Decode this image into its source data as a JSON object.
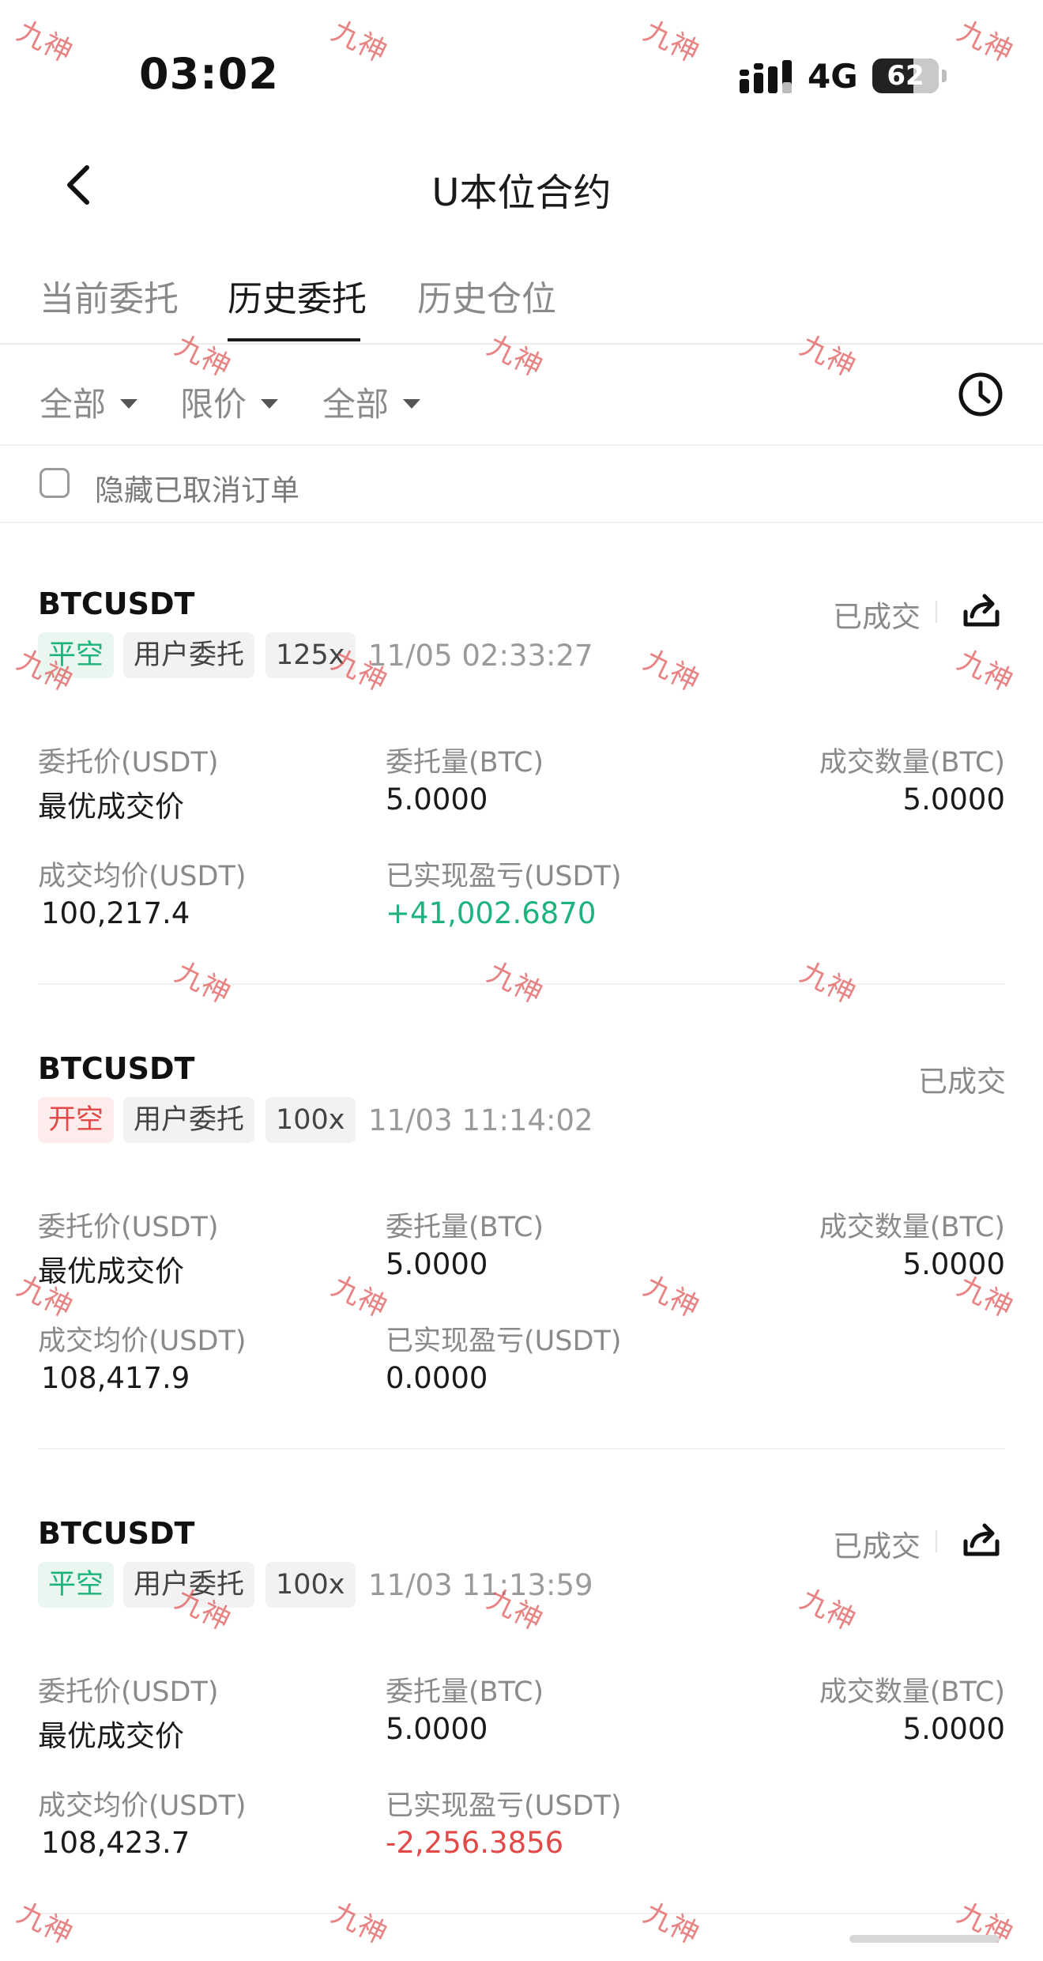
{
  "status_bar": {
    "time": "03:02",
    "network": "4G",
    "battery": "62",
    "battery_level": 0.62
  },
  "header": {
    "title": "U本位合约",
    "back_icon": "chevron-left-icon"
  },
  "tabs": [
    {
      "label": "当前委托",
      "active": false
    },
    {
      "label": "历史委托",
      "active": true
    },
    {
      "label": "历史仓位",
      "active": false
    }
  ],
  "filters": [
    {
      "label": "全部"
    },
    {
      "label": "限价"
    },
    {
      "label": "全部"
    }
  ],
  "history_icon": "clock-icon",
  "hide_cancelled": {
    "label": "隐藏已取消订单",
    "checked": false
  },
  "labels": {
    "order_price": "委托价(USDT)",
    "order_qty": "委托量(BTC)",
    "filled_qty": "成交数量(BTC)",
    "avg_price": "成交均价(USDT)",
    "realized_pnl": "已实现盈亏(USDT)"
  },
  "orders": [
    {
      "symbol": "BTCUSDT",
      "status": "已成交",
      "share": true,
      "side": "平空",
      "source": "用户委托",
      "leverage": "125x",
      "time": "11/05 02:33:27",
      "order_price": "最优成交价",
      "order_qty": "5.0000",
      "filled_qty": "5.0000",
      "avg_price": "100,217.4",
      "pnl": "+41,002.6870",
      "pnl_color": "#1eb37c"
    },
    {
      "symbol": "BTCUSDT",
      "status": "已成交",
      "share": false,
      "side": "开空",
      "source": "用户委托",
      "leverage": "100x",
      "time": "11/03 11:14:02",
      "order_price": "最优成交价",
      "order_qty": "5.0000",
      "filled_qty": "5.0000",
      "avg_price": "108,417.9",
      "pnl": "0.0000",
      "pnl_color": "#1a1a1a"
    },
    {
      "symbol": "BTCUSDT",
      "status": "已成交",
      "share": true,
      "side": "平空",
      "source": "用户委托",
      "leverage": "100x",
      "time": "11/03 11:13:59",
      "order_price": "最优成交价",
      "order_qty": "5.0000",
      "filled_qty": "5.0000",
      "avg_price": "108,423.7",
      "pnl": "-2,256.3856",
      "pnl_color": "#e24a4a"
    }
  ],
  "watermark": {
    "text": "九神",
    "color": "#e05a5a"
  }
}
